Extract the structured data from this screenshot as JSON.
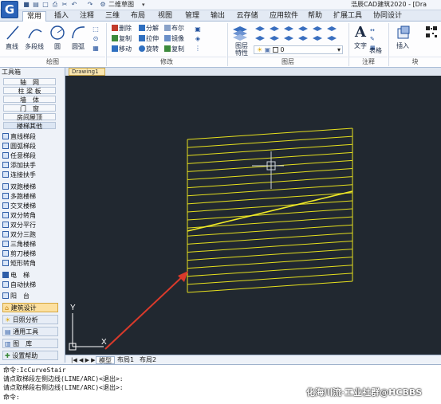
{
  "app": {
    "title": "浩辰CAD建筑2020 - [Dra",
    "logo_letter": "G",
    "workspace": "二维草图"
  },
  "ribbon": {
    "tabs": [
      "常用",
      "插入",
      "注释",
      "三维",
      "布局",
      "视图",
      "管理",
      "输出",
      "云存储",
      "应用软件",
      "帮助",
      "扩展工具",
      "协同设计"
    ],
    "active_tab": "常用",
    "draw": {
      "line": "直线",
      "polyline": "多段线",
      "circle_label": "圆",
      "arc": "圆弧",
      "group": "绘图"
    },
    "modify": {
      "erase": "删除",
      "explode": "分解",
      "boolean": "布尔",
      "copy": "复制",
      "stretch": "拉伸",
      "mirror": "镜像",
      "move": "移动",
      "rotate": "旋转",
      "replicate": "复制",
      "group": "修改"
    },
    "layers": {
      "layer_props": "图层特性",
      "current_layer": "0",
      "group": "图层"
    },
    "annotation": {
      "text": "文字",
      "table": "表格",
      "group": "注释"
    },
    "block": {
      "insert": "插入",
      "group": "块"
    }
  },
  "document": {
    "tab": "Drawing1"
  },
  "toolbox": {
    "title": "工具箱",
    "categories": [
      "轴　网",
      "柱 梁 板",
      "墙　体",
      "门　窗",
      "房间屋顶",
      "楼梯其他"
    ],
    "items": [
      "直线梯段",
      "圆弧梯段",
      "任意梯段",
      "添加扶手",
      "连接扶手",
      "双跑楼梯",
      "多跑楼梯",
      "交叉楼梯",
      "双分转角",
      "双分平行",
      "双分三跑",
      "三角楼梯",
      "剪刀楼梯",
      "矩形转角",
      "电　梯",
      "自动扶梯",
      "阳　台"
    ],
    "nav": [
      "建筑设计",
      "日照分析",
      "通用工具",
      "图　库",
      "设置帮助"
    ],
    "active_nav": "建筑设计"
  },
  "canvas": {
    "ucs_x": "X",
    "ucs_y": "Y",
    "colors": {
      "background": "#212830",
      "stair": "#e6e01e",
      "arrow": "#d93a2b"
    }
  },
  "layout_tabs": [
    "模型",
    "布局1",
    "布局2"
  ],
  "active_layout": "模型",
  "command": {
    "lines": [
      "命令:IcCurveStair",
      "请点取梯段左侧边线(LINE/ARC)<退出>:",
      "请点取梯段右侧边线(LINE/ARC)<退出>:",
      "命令:"
    ]
  },
  "watermark": "化海川流·工业社群@HCBBS"
}
